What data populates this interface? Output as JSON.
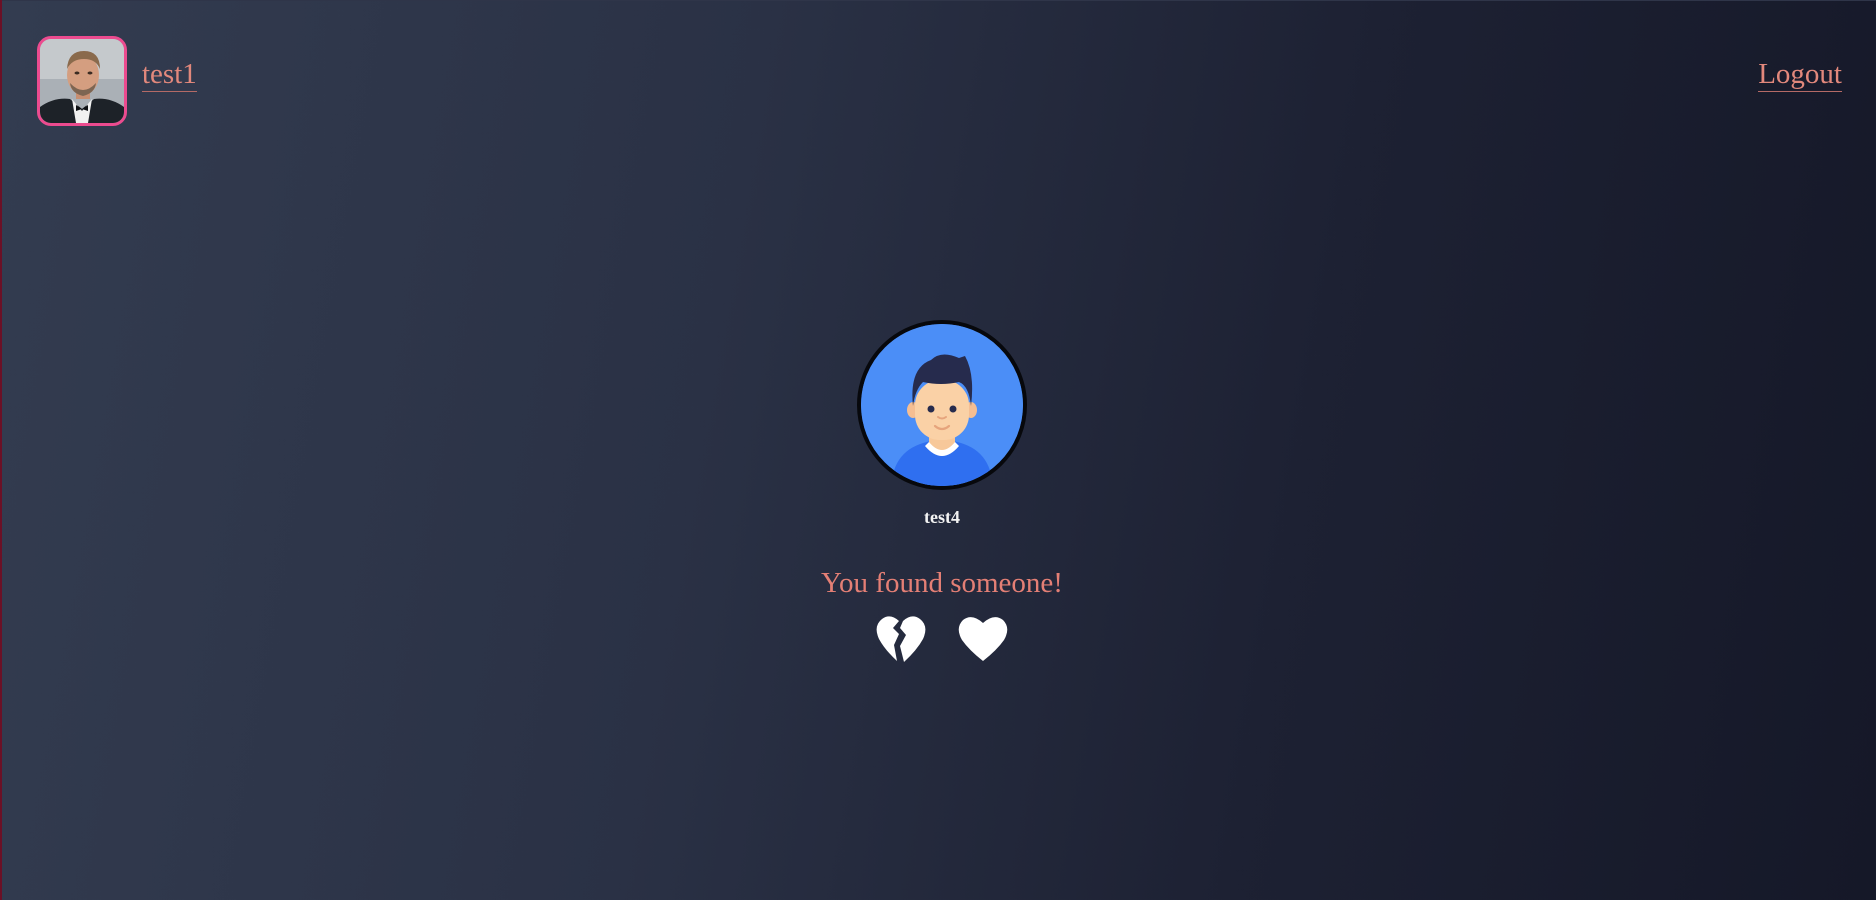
{
  "header": {
    "user": {
      "name": "test1",
      "avatar_icon": "user-photo-avatar",
      "avatar_border_color": "#ec4b8f"
    },
    "logout_label": "Logout",
    "link_color": "#e2887c"
  },
  "match": {
    "name": "test4",
    "avatar_icon": "default-user-avatar",
    "avatar_background": "#4b8ef7",
    "message": "You found someone!",
    "message_color": "#e47f75",
    "actions": [
      {
        "id": "reject",
        "icon": "broken-heart-icon"
      },
      {
        "id": "like",
        "icon": "heart-icon"
      }
    ]
  },
  "colors": {
    "background_start": "#333c50",
    "background_end": "#151828"
  }
}
